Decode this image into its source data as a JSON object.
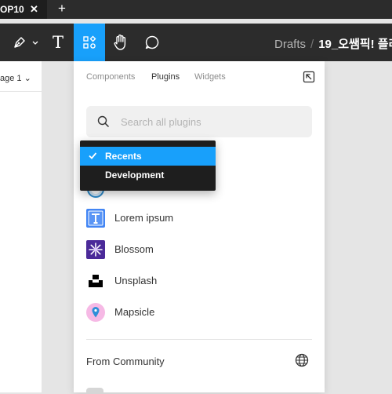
{
  "tab": {
    "title": "OP10",
    "close_glyph": "✕",
    "new_glyph": "+"
  },
  "toolbar": {
    "tools": [
      "pen-tool",
      "text-tool",
      "resources-tool",
      "hand-tool",
      "comment-tool"
    ],
    "active_tool": "resources-tool",
    "text_tool_glyph": "T"
  },
  "breadcrumb": {
    "project": "Drafts",
    "separator": "/",
    "file": "19_오쌤픽! 플러"
  },
  "left_panel": {
    "page_selector": "age 1 ⌄"
  },
  "resources_panel": {
    "tabs": [
      {
        "label": "Components",
        "active": false
      },
      {
        "label": "Plugins",
        "active": true
      },
      {
        "label": "Widgets",
        "active": false
      }
    ],
    "search_placeholder": "Search all plugins",
    "plugins": [
      {
        "label": "Lorem ipsum",
        "icon": "lorem-ipsum-icon"
      },
      {
        "label": "Blossom",
        "icon": "blossom-icon"
      },
      {
        "label": "Unsplash",
        "icon": "unsplash-icon"
      },
      {
        "label": "Mapsicle",
        "icon": "mapsicle-icon"
      }
    ],
    "community_label": "From Community"
  },
  "dropdown": {
    "items": [
      {
        "label": "Recents",
        "selected": true
      },
      {
        "label": "Development",
        "selected": false
      }
    ]
  },
  "colors": {
    "accent": "#18a0fb",
    "toolbar_bg": "#2c2c2c",
    "menu_bg": "#1e1e1e"
  }
}
